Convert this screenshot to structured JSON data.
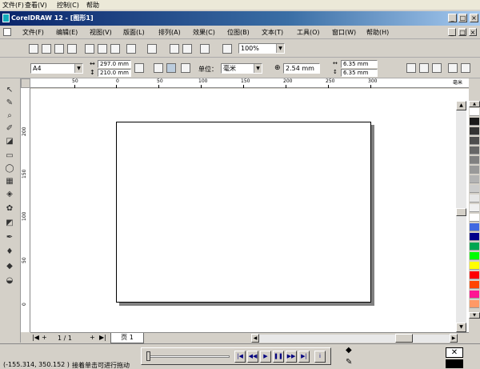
{
  "outer_menu": {
    "file": "文件(F)",
    "view": "查看(V)",
    "control": "控制(C)",
    "help": "帮助"
  },
  "window": {
    "title": "CorelDRAW 12 - [图形1]",
    "minimize": "_",
    "maximize": "□",
    "close": "×"
  },
  "menu": {
    "items": [
      "文件(F)",
      "编辑(E)",
      "视图(V)",
      "版面(L)",
      "排列(A)",
      "效果(C)",
      "位图(B)",
      "文本(T)",
      "工具(O)",
      "窗口(W)",
      "帮助(H)"
    ]
  },
  "toolbar": {
    "zoom": "100%"
  },
  "property_bar": {
    "paper": "A4",
    "width": "297.0 mm",
    "height": "210.0 mm",
    "units_label": "单位：",
    "units": "毫米",
    "nudge": "2.54 mm",
    "dup_x": "6.35 mm",
    "dup_y": "6.35 mm"
  },
  "ruler": {
    "h_labels": [
      "50",
      "0",
      "50",
      "100",
      "150",
      "200",
      "250",
      "300",
      "毫米"
    ],
    "v_labels": [
      "200",
      "150",
      "100",
      "50",
      "0"
    ]
  },
  "page_nav": {
    "count": "1 / 1",
    "tab": "页 1"
  },
  "status": {
    "coords": "(-155.314, 350.152 )",
    "hint": "接着单击可进行拖动"
  },
  "palette": {
    "colors": [
      "#ffffff",
      "#1a1a1a",
      "#333333",
      "#4d4d4d",
      "#666666",
      "#808080",
      "#999999",
      "#b3b3b3",
      "#cccccc",
      "#e6e6e6",
      "#f0f0f0",
      "#ffffff",
      "#4169e1",
      "#00008b",
      "#00a651",
      "#00ff00",
      "#ffff00",
      "#ff0000",
      "#ff4500",
      "#ff1493",
      "#ff9966"
    ]
  }
}
